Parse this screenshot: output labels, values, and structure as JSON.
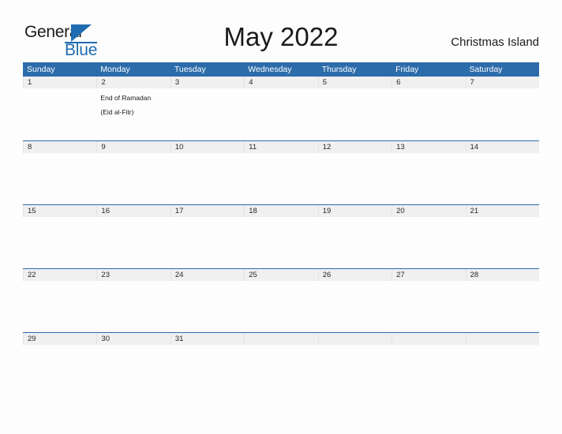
{
  "brand": {
    "name_part1": "General",
    "name_part2": "Blue",
    "triangle_icon": "triangle-icon",
    "color_primary": "#1f6cb0",
    "color_text": "#1a1a1a"
  },
  "header": {
    "title": "May 2022",
    "region": "Christmas Island"
  },
  "calendar": {
    "accent_color": "#2d6cab",
    "daynum_band_color": "#f0f0f0",
    "weekdays": [
      "Sunday",
      "Monday",
      "Tuesday",
      "Wednesday",
      "Thursday",
      "Friday",
      "Saturday"
    ],
    "weeks": [
      {
        "days": [
          {
            "num": "1",
            "event": ""
          },
          {
            "num": "2",
            "event": "End of Ramadan\n(Eid al-Fitr)"
          },
          {
            "num": "3",
            "event": ""
          },
          {
            "num": "4",
            "event": ""
          },
          {
            "num": "5",
            "event": ""
          },
          {
            "num": "6",
            "event": ""
          },
          {
            "num": "7",
            "event": ""
          }
        ]
      },
      {
        "days": [
          {
            "num": "8",
            "event": ""
          },
          {
            "num": "9",
            "event": ""
          },
          {
            "num": "10",
            "event": ""
          },
          {
            "num": "11",
            "event": ""
          },
          {
            "num": "12",
            "event": ""
          },
          {
            "num": "13",
            "event": ""
          },
          {
            "num": "14",
            "event": ""
          }
        ]
      },
      {
        "days": [
          {
            "num": "15",
            "event": ""
          },
          {
            "num": "16",
            "event": ""
          },
          {
            "num": "17",
            "event": ""
          },
          {
            "num": "18",
            "event": ""
          },
          {
            "num": "19",
            "event": ""
          },
          {
            "num": "20",
            "event": ""
          },
          {
            "num": "21",
            "event": ""
          }
        ]
      },
      {
        "days": [
          {
            "num": "22",
            "event": ""
          },
          {
            "num": "23",
            "event": ""
          },
          {
            "num": "24",
            "event": ""
          },
          {
            "num": "25",
            "event": ""
          },
          {
            "num": "26",
            "event": ""
          },
          {
            "num": "27",
            "event": ""
          },
          {
            "num": "28",
            "event": ""
          }
        ]
      },
      {
        "days": [
          {
            "num": "29",
            "event": ""
          },
          {
            "num": "30",
            "event": ""
          },
          {
            "num": "31",
            "event": ""
          },
          {
            "num": "",
            "event": ""
          },
          {
            "num": "",
            "event": ""
          },
          {
            "num": "",
            "event": ""
          },
          {
            "num": "",
            "event": ""
          }
        ]
      }
    ]
  }
}
